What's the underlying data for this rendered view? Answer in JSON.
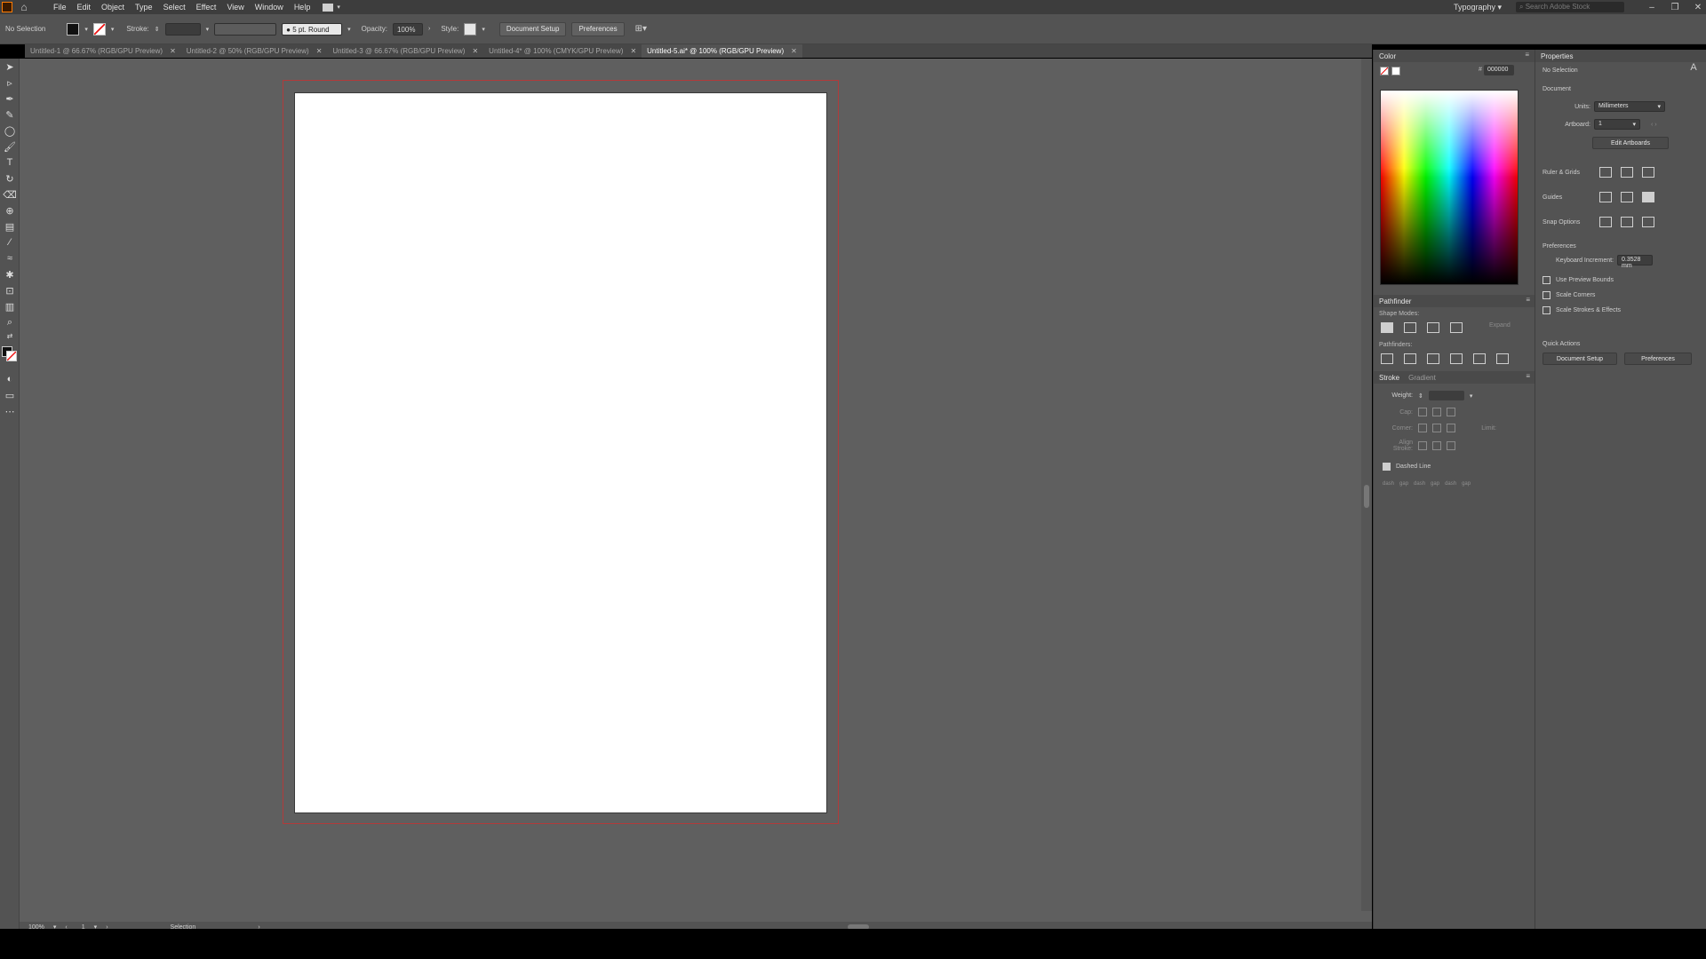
{
  "menubar": {
    "items": [
      "File",
      "Edit",
      "Object",
      "Type",
      "Select",
      "Effect",
      "View",
      "Window",
      "Help"
    ],
    "workspace": "Typography",
    "search_placeholder": "Search Adobe Stock"
  },
  "control": {
    "selection": "No Selection",
    "stroke_label": "Stroke:",
    "brush": "5 pt. Round",
    "opacity_label": "Opacity:",
    "opacity_value": "100%",
    "style_label": "Style:",
    "doc_setup": "Document Setup",
    "preferences": "Preferences"
  },
  "tabs": [
    {
      "label": "Untitled-1 @ 66.67% (RGB/GPU Preview)",
      "active": false
    },
    {
      "label": "Untitled-2 @ 50% (RGB/GPU Preview)",
      "active": false
    },
    {
      "label": "Untitled-3 @ 66.67% (RGB/GPU Preview)",
      "active": false
    },
    {
      "label": "Untitled-4* @ 100% (CMYK/GPU Preview)",
      "active": false
    },
    {
      "label": "Untitled-5.ai* @ 100% (RGB/GPU Preview)",
      "active": true
    }
  ],
  "status": {
    "zoom": "100%",
    "artboard": "1",
    "mode": "Selection"
  },
  "color_panel": {
    "title": "Color",
    "hex": "000000"
  },
  "pathfinder": {
    "title": "Pathfinder",
    "shape_modes": "Shape Modes:",
    "expand": "Expand",
    "pathfinders": "Pathfinders:"
  },
  "stroke_panel": {
    "title": "Stroke",
    "tab2": "Gradient",
    "weight": "Weight:",
    "cap": "Cap:",
    "corner": "Corner:",
    "limit": "Limit:",
    "align": "Align Stroke:",
    "dashed": "Dashed Line",
    "dash_cells": [
      "dash",
      "gap",
      "dash",
      "gap",
      "dash",
      "gap"
    ]
  },
  "properties": {
    "title": "Properties",
    "no_selection": "No Selection",
    "document": "Document",
    "units_label": "Units:",
    "units_value": "Millimeters",
    "artboard_label": "Artboard:",
    "artboard_value": "1",
    "edit_artboards": "Edit Artboards",
    "ruler_grids": "Ruler & Grids",
    "guides": "Guides",
    "snap": "Snap Options",
    "preferences_section": "Preferences",
    "kb_label": "Keyboard Increment:",
    "kb_value": "0.3528 mm",
    "cb1": "Use Preview Bounds",
    "cb2": "Scale Corners",
    "cb3": "Scale Strokes & Effects",
    "quick_actions": "Quick Actions",
    "qa_doc_setup": "Document Setup",
    "qa_prefs": "Preferences"
  },
  "accent": {
    "bleed": "#b23a3a",
    "logo": "#ff7c00"
  }
}
